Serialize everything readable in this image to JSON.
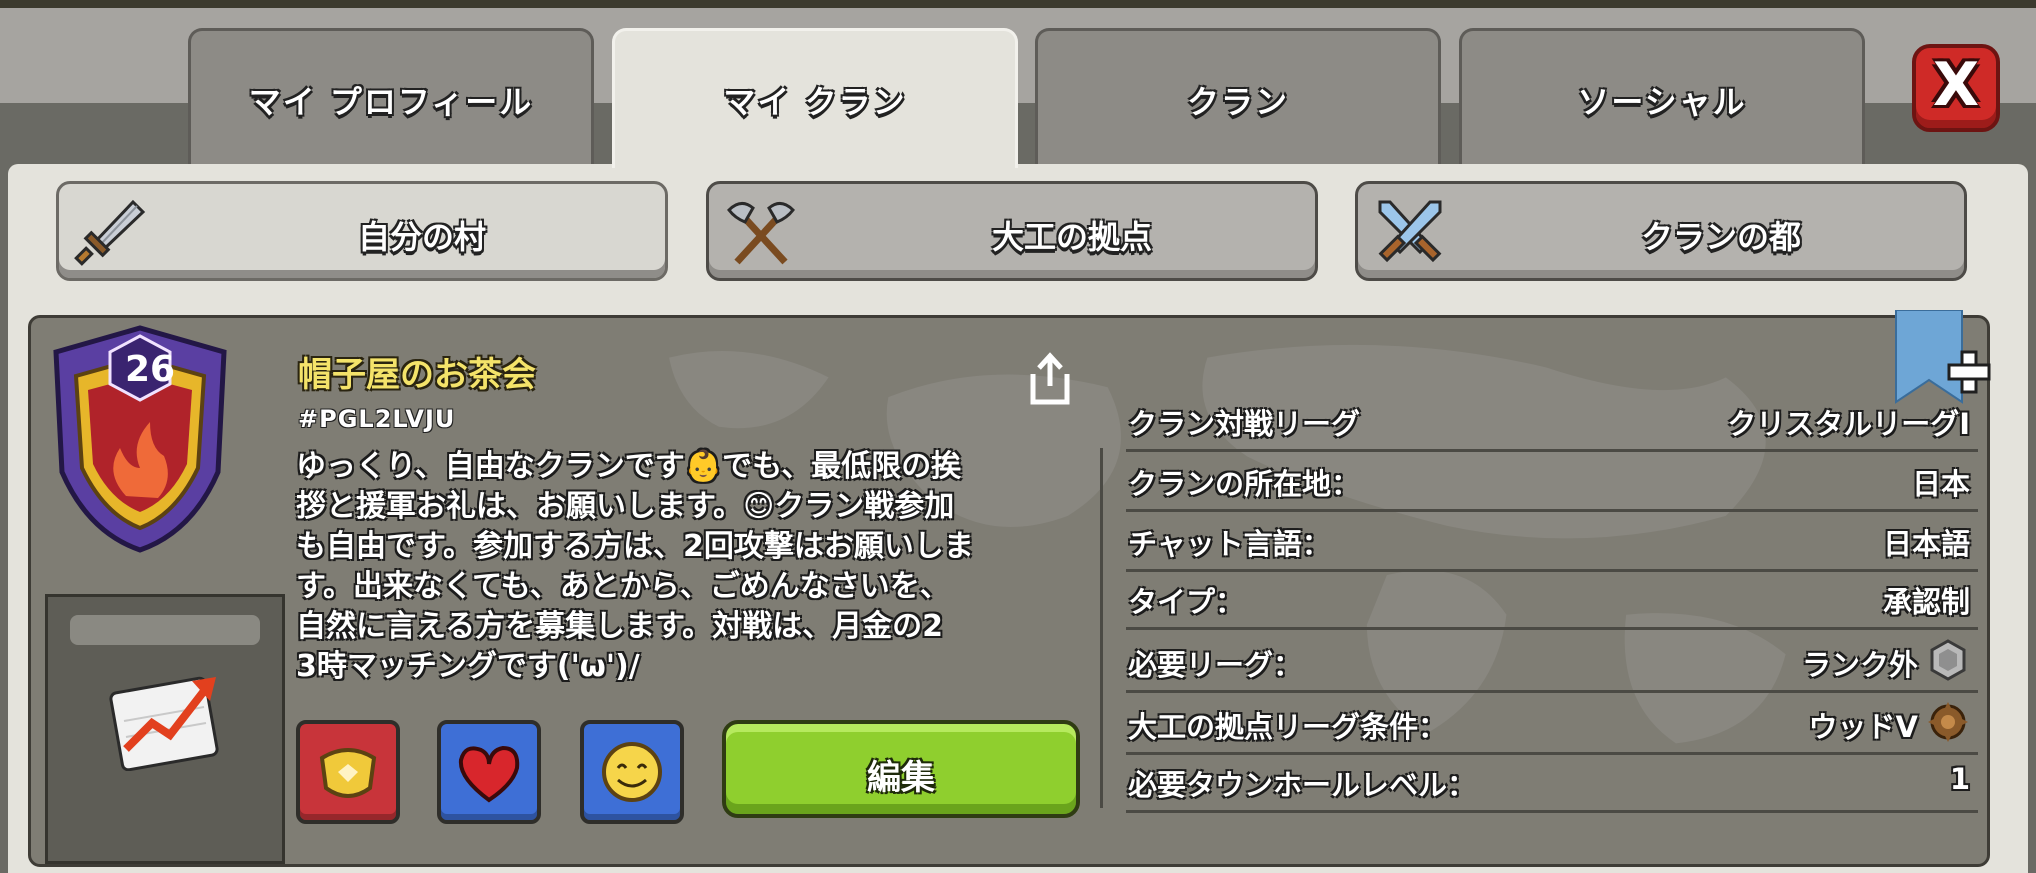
{
  "tabs": [
    {
      "label": "マイ プロフィール",
      "active": false
    },
    {
      "label": "マイ クラン",
      "active": true
    },
    {
      "label": "クラン",
      "active": false
    },
    {
      "label": "ソーシャル",
      "active": false
    }
  ],
  "close_label": "X",
  "subtabs": [
    {
      "label": "自分の村",
      "icon": "sword-icon",
      "active": true
    },
    {
      "label": "大工の拠点",
      "icon": "crossed-axes-icon",
      "active": false
    },
    {
      "label": "クランの都",
      "icon": "crossed-swords-icon",
      "active": false
    }
  ],
  "clan": {
    "level": "26",
    "name": "帽子屋のお茶会",
    "tag": "#PGL2LVJU",
    "description": "ゆっくり、自由なクランです👶でも、最低限の挨\n拶と援軍お礼は、お願いします。😊クラン戦参加\nも自由です。参加する方は、2回攻撃はお願いしま\nす。出来なくても、あとから、ごめんなさいを、\n自然に言える方を募集します。対戦は、月金の2\n3時マッチングです('ω')/"
  },
  "buttons": {
    "edit_label": "編集"
  },
  "info": [
    {
      "label": "クラン対戦リーグ",
      "value": "クリスタルリーグI"
    },
    {
      "label": "クランの所在地：",
      "value": "日本"
    },
    {
      "label": "チャット言語：",
      "value": "日本語"
    },
    {
      "label": "タイプ：",
      "value": "承認制"
    },
    {
      "label": "必要リーグ：",
      "value": "ランク外",
      "icon": "unranked-league-icon"
    },
    {
      "label": "大工の拠点リーグ条件：",
      "value": "ウッドV",
      "icon": "wood-league-icon"
    },
    {
      "label": "必要タウンホールレベル：",
      "value": "1"
    }
  ],
  "colors": {
    "clan_name": "#f4e36a",
    "edit_button": "#8fcf2e",
    "close_button": "#cf2a27",
    "trophy_red": "#c8343a",
    "trophy_blue": "#3e6fd6"
  }
}
